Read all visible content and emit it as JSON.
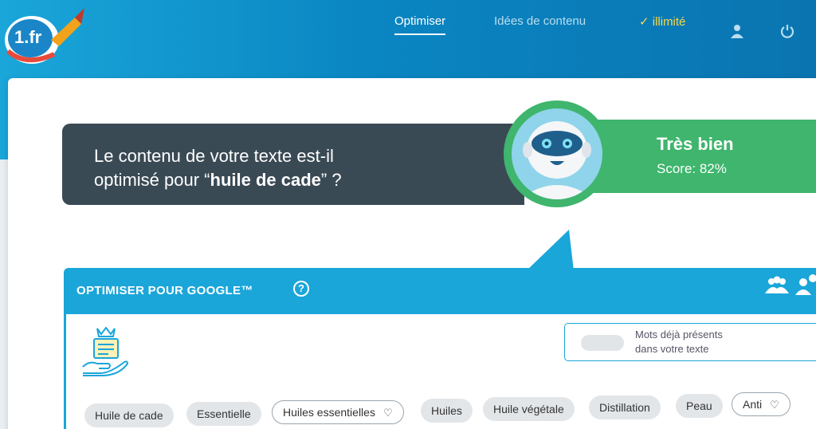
{
  "logo": {
    "text": "1.fr"
  },
  "nav": {
    "items": [
      {
        "label": "Optimiser",
        "active": true
      },
      {
        "label": "Idées de contenu",
        "active": false
      },
      {
        "label": "✓ illimité",
        "active": false
      }
    ],
    "icons": [
      "user-icon",
      "power-icon"
    ]
  },
  "question": {
    "line1": "Le contenu de votre texte est-il",
    "line2_prefix": "optimisé pour “",
    "keyword": "huile de cade",
    "line2_suffix": "” ?"
  },
  "score": {
    "title": "Très bien",
    "value": "Score: 82%",
    "percent": 82
  },
  "panel": {
    "title": "OPTIMISER POUR GOOGLE™",
    "help": "?",
    "legend_line1": "Mots déjà présents",
    "legend_line2": "dans votre texte"
  },
  "tags": [
    {
      "label": "Huile de cade",
      "outlined": false,
      "heart": false
    },
    {
      "label": "Essentielle",
      "outlined": false,
      "heart": false
    },
    {
      "label": "Huiles essentielles",
      "outlined": true,
      "heart": true
    },
    {
      "label": "Huiles",
      "outlined": false,
      "heart": false
    },
    {
      "label": "Huile végétale",
      "outlined": false,
      "heart": false
    },
    {
      "label": "Distillation",
      "outlined": false,
      "heart": false
    },
    {
      "label": "Peau",
      "outlined": false,
      "heart": false
    },
    {
      "label": "Anti",
      "outlined": true,
      "heart": true
    }
  ],
  "colors": {
    "header": "#0a86c2",
    "accent": "#1aa6d9",
    "score_green": "#3fb56d",
    "question_bg": "#3a4a55",
    "unlimited": "#f5d94a"
  }
}
